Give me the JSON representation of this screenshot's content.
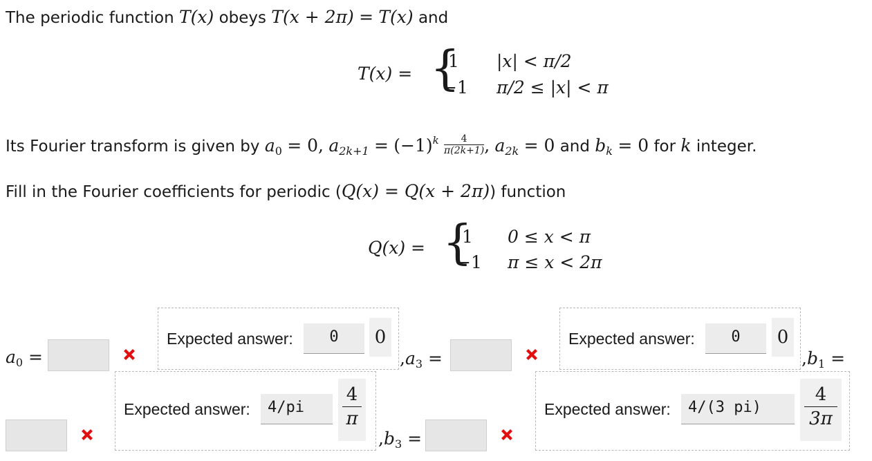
{
  "intro": {
    "text1": "The periodic function",
    "text2": "obeys",
    "text3": "and",
    "t_of_x": "T(x)",
    "periodic_eq_lhs": "T(x + 2π)",
    "eq": "=",
    "periodic_eq_rhs": "T(x)"
  },
  "t_def": {
    "lhs": "T(x) =",
    "case1_value": "1",
    "case1_cond": "|x| < π/2",
    "case2_value": "−1",
    "case2_cond": "π/2 ≤ |x| < π"
  },
  "fourier": {
    "text_lead": "Its Fourier transform is given by",
    "a0_expr": "a",
    "a0_sub": "0",
    "a0_val": "= 0,",
    "a2k1": "a",
    "a2k1_sub": "2k+1",
    "eq": "=",
    "minus_one": "(−1)",
    "k_sup": "k",
    "frac_num": "4",
    "frac_den": "π(2k+1)",
    "comma": ",",
    "a2k": "a",
    "a2k_sub": "2k",
    "a2k_val": "= 0",
    "and": "and",
    "bk": "b",
    "bk_sub": "k",
    "bk_val": "= 0",
    "for_text": "for",
    "k_var": "k",
    "integer_text": "integer."
  },
  "fill": {
    "text_lead": "Fill in the Fourier coefficients for periodic (",
    "expr": "Q(x) = Q(x + 2π)",
    "text_tail": ") function"
  },
  "q_def": {
    "lhs": "Q(x) =",
    "case1_value": "1",
    "case1_cond": "0 ≤ x < π",
    "case2_value": "−1",
    "case2_cond": "π ≤ x < 2π"
  },
  "answers": {
    "a0_label": "a",
    "a0_sub": "0",
    "eq": "=",
    "a3_prefix": ",",
    "a3_label": "a",
    "a3_sub": "3",
    "b1_prefix": ",",
    "b1_label": "b",
    "b1_sub": "1",
    "b3_prefix": ",",
    "b3_label": "b",
    "b3_sub": "3",
    "expected_label": "Expected answer:",
    "a0_expected_code": "0",
    "a0_expected_rendered": "0",
    "a3_expected_code": "0",
    "a3_expected_rendered": "0",
    "b1_expected_code": "4/pi",
    "b1_rendered_num": "4",
    "b1_rendered_den": "π",
    "b3_expected_code": "4/(3 pi)",
    "b3_rendered_num": "4",
    "b3_rendered_den": "3π",
    "a0_input_value": "",
    "a3_input_value": "",
    "b1_input_value": "",
    "b3_input_value": ""
  },
  "colors": {
    "incorrect": "#e01010",
    "input_bg": "#e6e6e6"
  }
}
